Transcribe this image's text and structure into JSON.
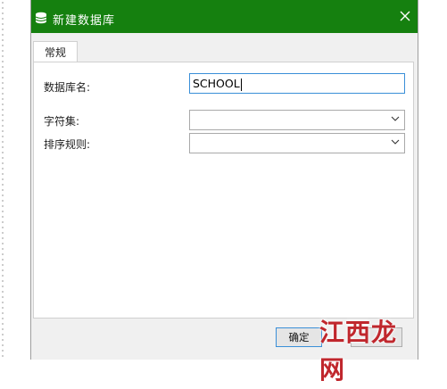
{
  "window": {
    "title": "新建数据库",
    "close_icon": "close-icon",
    "app_icon": "database-icon"
  },
  "tabs": [
    {
      "label": "常规"
    }
  ],
  "form": {
    "db_name_label": "数据库名:",
    "db_name_value": "SCHOOL",
    "charset_label": "字符集:",
    "charset_value": "",
    "collation_label": "排序规则:",
    "collation_value": ""
  },
  "footer": {
    "ok_label": "确定",
    "cancel_label": ""
  },
  "watermark": {
    "text": "江西龙网"
  },
  "colors": {
    "titlebar": "#15800f",
    "focus_border": "#3a8fd8",
    "watermark": "#c0272d"
  }
}
